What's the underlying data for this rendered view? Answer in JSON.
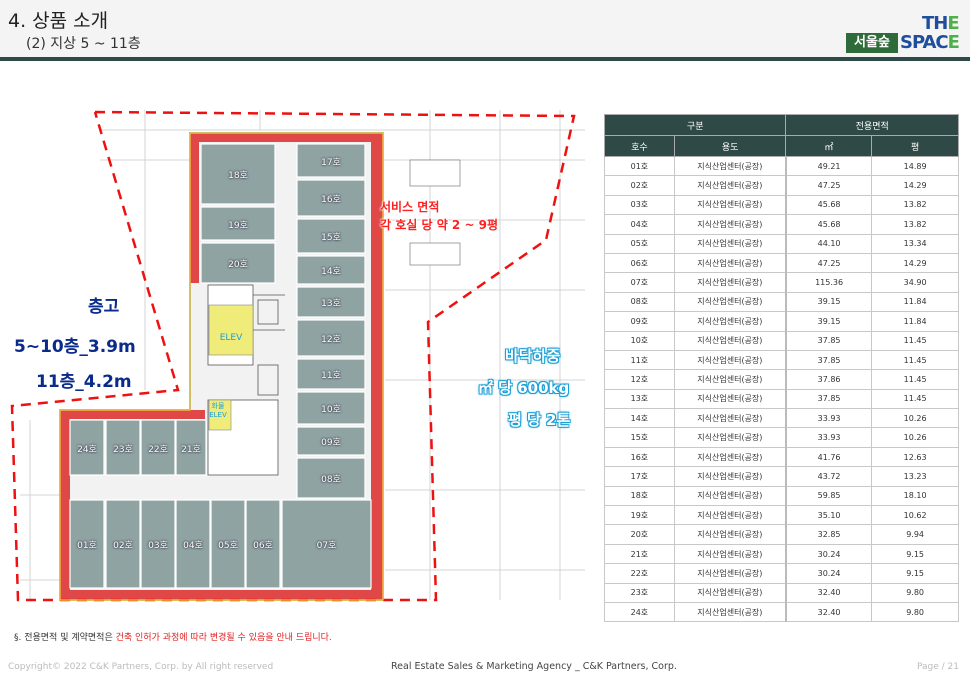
{
  "header": {
    "title": "4. 상품 소개",
    "subtitle": "(2) 지상 5 ~ 11층",
    "logo_box": "서울숲",
    "logo_the": "TH",
    "logo_the_e": "E",
    "logo_space": "SPAC",
    "logo_space_e": "E"
  },
  "plan": {
    "height_title": "층고",
    "height_line1": "5~10층_3.9m",
    "height_line2": "11층_4.2m",
    "load_title": "바닥하중",
    "load_line1": "㎡ 당 600kg",
    "load_line2": "평 당 2톤",
    "service_line1": "서비스 면적",
    "service_line2": "각 호실 당 약 2 ~ 9평",
    "elev_label": "ELEV",
    "elev_small": "화물\nELEV",
    "units": [
      "01호",
      "02호",
      "03호",
      "04호",
      "05호",
      "06호",
      "07호",
      "08호",
      "09호",
      "10호",
      "11호",
      "12호",
      "13호",
      "14호",
      "15호",
      "16호",
      "17호",
      "18호",
      "19호",
      "20호",
      "21호",
      "22호",
      "23호",
      "24호"
    ]
  },
  "note": {
    "prefix": "§. 전용면적 및 계약면적은 ",
    "highlight": "건축 인허가 과정에 따라 변경될 수 있음을 안내 드립니다."
  },
  "table": {
    "group1": "구분",
    "group2": "전용면적",
    "col_unit": "호수",
    "col_use": "용도",
    "col_m2": "㎡",
    "col_py": "평",
    "rows": [
      [
        "01호",
        "지식산업센터(공장)",
        "49.21",
        "14.89"
      ],
      [
        "02호",
        "지식산업센터(공장)",
        "47.25",
        "14.29"
      ],
      [
        "03호",
        "지식산업센터(공장)",
        "45.68",
        "13.82"
      ],
      [
        "04호",
        "지식산업센터(공장)",
        "45.68",
        "13.82"
      ],
      [
        "05호",
        "지식산업센터(공장)",
        "44.10",
        "13.34"
      ],
      [
        "06호",
        "지식산업센터(공장)",
        "47.25",
        "14.29"
      ],
      [
        "07호",
        "지식산업센터(공장)",
        "115.36",
        "34.90"
      ],
      [
        "08호",
        "지식산업센터(공장)",
        "39.15",
        "11.84"
      ],
      [
        "09호",
        "지식산업센터(공장)",
        "39.15",
        "11.84"
      ],
      [
        "10호",
        "지식산업센터(공장)",
        "37.85",
        "11.45"
      ],
      [
        "11호",
        "지식산업센터(공장)",
        "37.85",
        "11.45"
      ],
      [
        "12호",
        "지식산업센터(공장)",
        "37.86",
        "11.45"
      ],
      [
        "13호",
        "지식산업센터(공장)",
        "37.85",
        "11.45"
      ],
      [
        "14호",
        "지식산업센터(공장)",
        "33.93",
        "10.26"
      ],
      [
        "15호",
        "지식산업센터(공장)",
        "33.93",
        "10.26"
      ],
      [
        "16호",
        "지식산업센터(공장)",
        "41.76",
        "12.63"
      ],
      [
        "17호",
        "지식산업센터(공장)",
        "43.72",
        "13.23"
      ],
      [
        "18호",
        "지식산업센터(공장)",
        "59.85",
        "18.10"
      ],
      [
        "19호",
        "지식산업센터(공장)",
        "35.10",
        "10.62"
      ],
      [
        "20호",
        "지식산업센터(공장)",
        "32.85",
        "9.94"
      ],
      [
        "21호",
        "지식산업센터(공장)",
        "30.24",
        "9.15"
      ],
      [
        "22호",
        "지식산업센터(공장)",
        "30.24",
        "9.15"
      ],
      [
        "23호",
        "지식산업센터(공장)",
        "32.40",
        "9.80"
      ],
      [
        "24호",
        "지식산업센터(공장)",
        "32.40",
        "9.80"
      ]
    ]
  },
  "footer": {
    "copyright": "Copyright© 2022 C&K Partners, Corp. by  All right reserved",
    "center": "Real Estate Sales & Marketing Agency _ C&K Partners, Corp.",
    "page": "Page / 21"
  },
  "colors": {
    "header_bar": "#2d4a48",
    "table_header": "#2f4a46",
    "unit_fill": "#8fa3a3",
    "service_fill": "#e04848",
    "dash_red": "#ee1111"
  }
}
